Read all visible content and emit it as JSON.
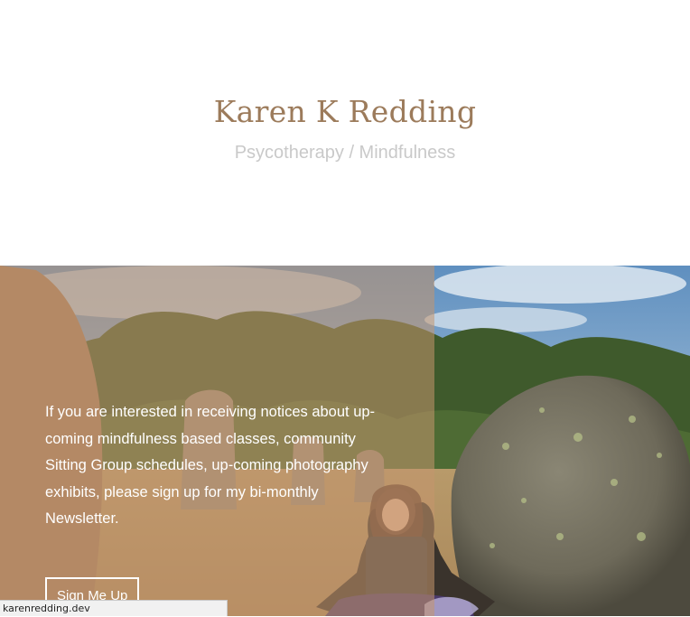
{
  "header": {
    "site_title": "Karen K Redding",
    "tagline": "Psycotherapy / Mindfulness"
  },
  "hero": {
    "text": "If you are interested in receiving notices about up-coming mindfulness based classes, community Sitting Group schedules, up-coming photography exhibits, please sign up for my bi-monthly Newsletter.",
    "button_label": "Sign Me Up"
  },
  "status_bar": {
    "url": "karenredding.dev"
  },
  "colors": {
    "title": "#9c7b5b",
    "tagline": "#c9c9c9",
    "overlay": "#c4966e"
  }
}
